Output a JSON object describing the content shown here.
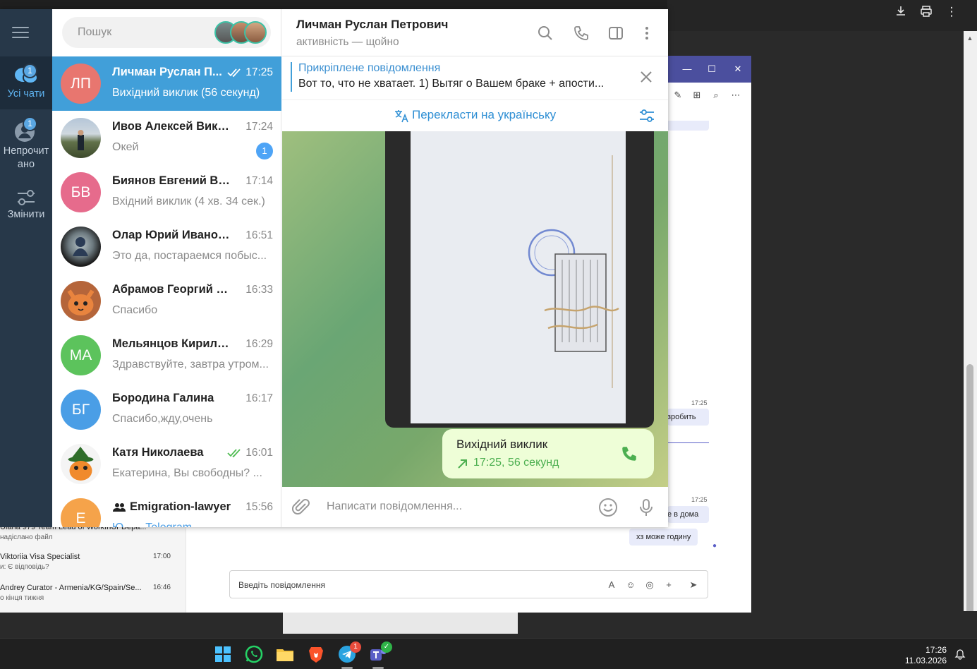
{
  "telegram": {
    "rail": {
      "all_chats": "Усі чати",
      "all_chats_badge": "1",
      "unread_line1": "Непрочит",
      "unread_line2": "ано",
      "unread_badge": "1",
      "edit": "Змінити"
    },
    "search_placeholder": "Пошук",
    "chats": [
      {
        "initials": "ЛП",
        "name": "Личман Руслан П...",
        "time": "17:25",
        "preview": "Вихідний виклик (56 секунд)",
        "color": "#e8766f",
        "active": true,
        "read": true
      },
      {
        "initials": "",
        "name": "Ивов Алексей Викто...",
        "time": "17:24",
        "preview": "Окей",
        "unread": "1",
        "photo": "mountain"
      },
      {
        "initials": "БВ",
        "name": "Биянов Евгений Вал...",
        "time": "17:14",
        "preview": "Вхідний виклик (4 хв. 34 сек.)",
        "color": "#e66b8c"
      },
      {
        "initials": "",
        "name": "Олар Юрий Иванович",
        "time": "16:51",
        "preview": "Это да, постараемся побыс...",
        "photo": "portrait"
      },
      {
        "initials": "",
        "name": "Абрамов Георгий Ле...",
        "time": "16:33",
        "preview": "Спасибо",
        "photo": "cat"
      },
      {
        "initials": "МА",
        "name": "Мельянцов Кирилл ...",
        "time": "16:29",
        "preview": "Здравствуйте, завтра утром...",
        "color": "#5cc35c"
      },
      {
        "initials": "БГ",
        "name": "Бородина Галина",
        "time": "16:17",
        "preview": "Спасибо,жду,очень",
        "color": "#4a9ee6"
      },
      {
        "initials": "",
        "name": "Катя Николаева",
        "time": "16:01",
        "preview": "Екатерина, Вы свободны? ...",
        "photo": "witch",
        "read": true
      },
      {
        "initials": "E",
        "name": "Emigration-lawyer",
        "time": "15:56",
        "preview": "Ю... ...Telegram",
        "color": "#f5a34a",
        "group": true
      }
    ],
    "header": {
      "name": "Личман Руслан Петрович",
      "status": "активність — щойно"
    },
    "pinned": {
      "title": "Прикріплене повідомлення",
      "text": "Вот то, что не хватает.  1) Вытяг о Вашем браке + апости..."
    },
    "translate_label": "Перекласти на українську",
    "call": {
      "title": "Вихідний виклик",
      "detail": "17:25, 56 секунд"
    },
    "composer_placeholder": "Написати повідомлення..."
  },
  "teams": {
    "chats": [
      {
        "name": "Ulana 979 Team Lead of WorkInUr Depa...",
        "preview": "надіслано файл",
        "time": ""
      },
      {
        "name": "Viktoriia Visa Specialist",
        "preview": "и: Є відповідь?",
        "time": "17:00"
      },
      {
        "name": "Andrey Curator - Armenia/KG/Spain/Se...",
        "preview": "о кінця тижня",
        "time": "16:46"
      }
    ],
    "messages": [
      {
        "time": "17:25",
        "text": "зробить"
      },
      {
        "time": "17:25",
        "text": "е в дома"
      },
      {
        "text": "хз може годину"
      }
    ],
    "input_placeholder": "Введіть повідомлення"
  },
  "taskbar": {
    "time": "17:26",
    "date": "11.03.2026",
    "telegram_badge": "1"
  }
}
